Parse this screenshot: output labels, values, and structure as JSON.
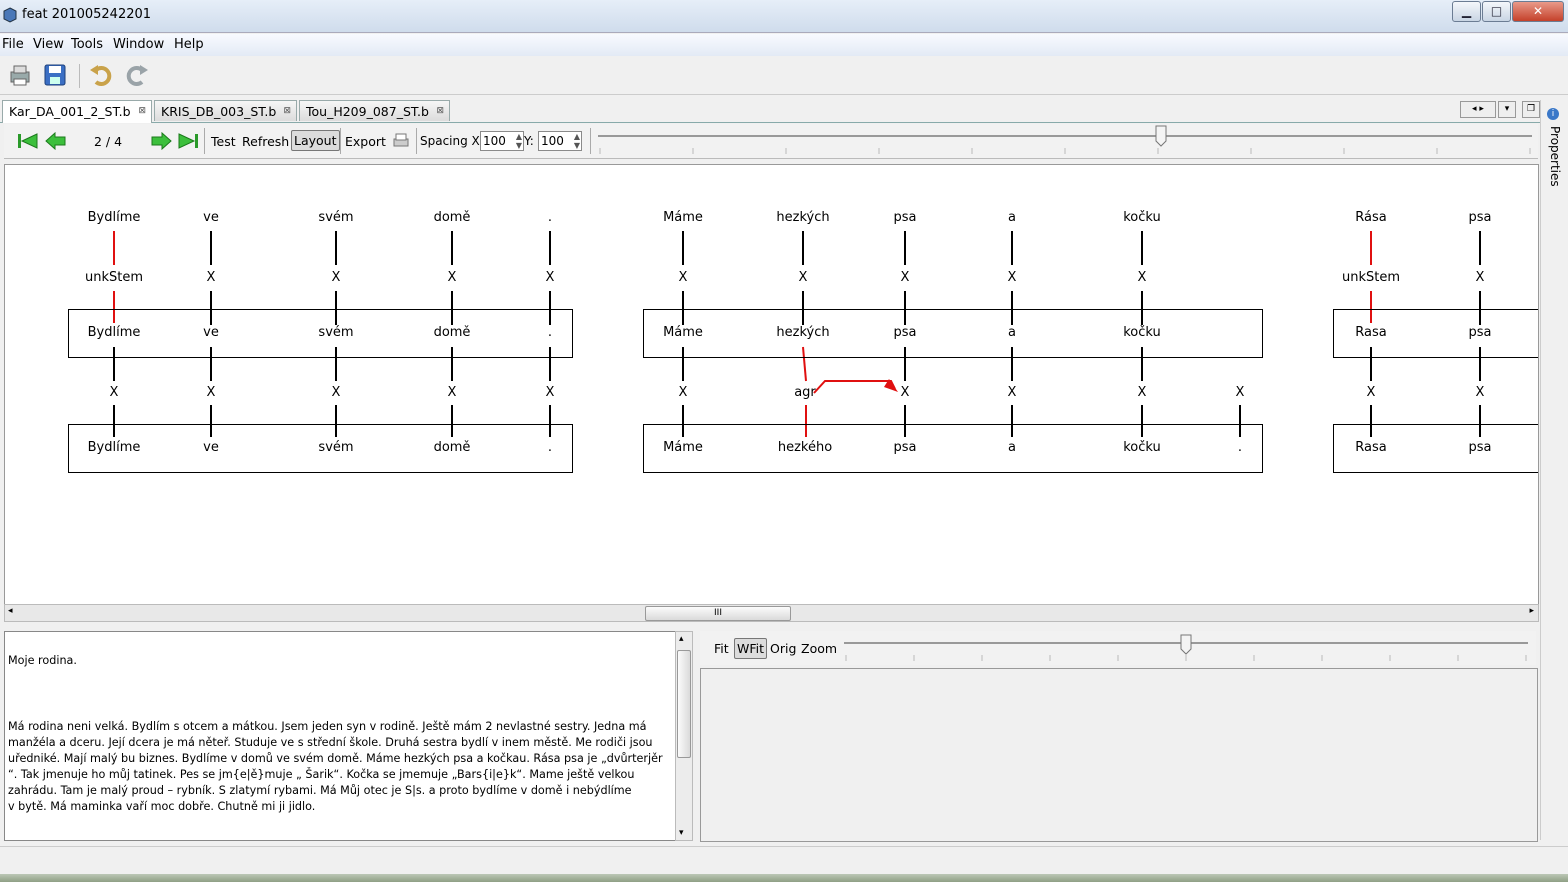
{
  "window": {
    "title": "feat 201005242201",
    "minimize": "▁",
    "maximize": "□",
    "close": "✕"
  },
  "menu": [
    "File",
    "View",
    "Tools",
    "Window",
    "Help"
  ],
  "toolbar": {
    "icons": [
      "print-icon",
      "save-icon",
      "undo-icon",
      "redo-icon"
    ]
  },
  "tabs": [
    {
      "label": "Kar_DA_001_2_ST.b",
      "close": "⊠"
    },
    {
      "label": "KRIS_DB_003_ST.b",
      "close": "⊠"
    },
    {
      "label": "Tou_H209_087_ST.b",
      "close": "⊠"
    }
  ],
  "doc_toolbar": {
    "page": "2 / 4",
    "test": "Test",
    "refresh": "Refresh",
    "layout": "Layout",
    "export": "Export",
    "spacing_label": "Spacing X:",
    "spacing_x": "100",
    "y_label": "Y:",
    "spacing_y": "100"
  },
  "tree": {
    "s1": {
      "top": [
        "Bydlíme",
        "ve",
        "svém",
        "domě",
        "."
      ],
      "row2": [
        "unkStem",
        "X",
        "X",
        "X",
        "X"
      ],
      "box1": [
        "Bydlíme",
        "ve",
        "svém",
        "domě",
        "."
      ],
      "row4": [
        "X",
        "X",
        "X",
        "X",
        "X"
      ],
      "box2": [
        "Bydlíme",
        "ve",
        "svém",
        "domě",
        "."
      ]
    },
    "s2": {
      "top": [
        "Máme",
        "hezkých",
        "psa",
        "a",
        "kočku"
      ],
      "row2": [
        "X",
        "X",
        "X",
        "X",
        "X"
      ],
      "box1": [
        "Máme",
        "hezkých",
        "psa",
        "a",
        "kočku"
      ],
      "row4": [
        "X",
        "agr",
        "X",
        "X",
        "X",
        "X"
      ],
      "box2": [
        "Máme",
        "hezkého",
        "psa",
        "a",
        "kočku",
        "."
      ]
    },
    "s3": {
      "top": [
        "Rása",
        "psa"
      ],
      "row2": [
        "unkStem",
        "X"
      ],
      "box1": [
        "Rasa",
        "psa"
      ],
      "row4": [
        "X",
        "X"
      ],
      "box2": [
        "Rasa",
        "psa"
      ]
    }
  },
  "scroll_grip": "III",
  "text": {
    "title": "Moje rodina.",
    "lines": [
      "Má rodina neni velká.  Bydlím s otcem a mátkou.  Jsem jeden syn v rodině.  Ještě mám 2 nevlastné sestry.  Jedna má",
      "manžéla a dceru.  Její dcera je má něteř.  Studuje ve s střední škole.  Druhá sestra bydlí v inem městě.  Me rodiči jsou",
      "uředniké.  Mají malý bu biznes.  Bydlíme v domů ve svém domě.  Máme hezkých psa a kočkau.  Rása psa je „dvůrterjěr",
      "“.  Tak jmenuje ho můj tatinek. Pes se jm{e|ě}muje „ Šarik“.  Kočka se jmemuje „Bars{i|e}k“.  Mame ještě velkou",
      "zahrádu.  Tam je malý proud – rybník.  S zlatymí rybami.  Má Můj otec je S|s. a proto bydlíme v domě i nebýdlíme",
      "v bytě.  Má maminka vaří moc dobře.  Chutně mi ji jidlo."
    ]
  },
  "image_toolbar": {
    "fit": "Fit",
    "wfit": "WFit",
    "orig": "Orig",
    "zoom": "Zoom"
  },
  "properties_label": "Properties"
}
